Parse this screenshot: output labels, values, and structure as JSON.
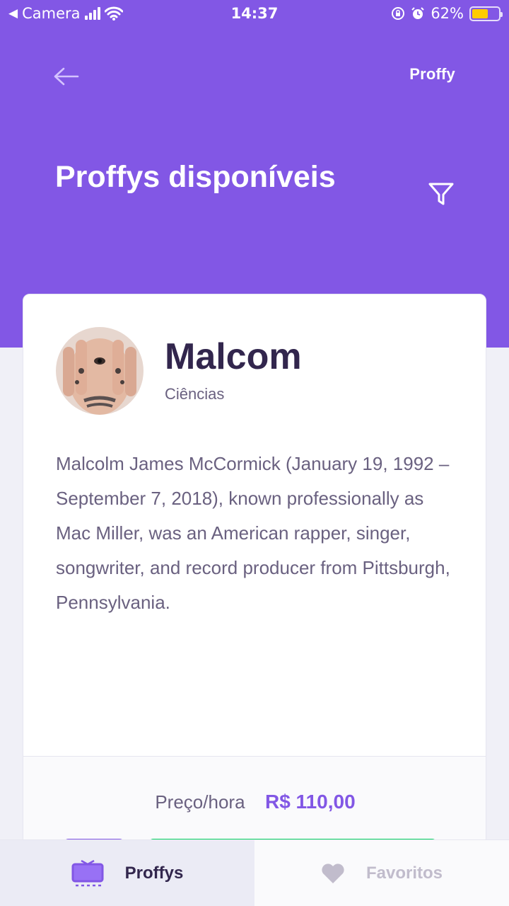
{
  "status_bar": {
    "carrier": "Camera",
    "time": "14:37",
    "battery_percent": "62%",
    "battery_level": 0.62,
    "icons": [
      "back-arrow-icon",
      "signal-icon",
      "wifi-icon",
      "rotation-lock-icon",
      "alarm-icon",
      "battery-icon"
    ]
  },
  "header": {
    "logo": "Proffy",
    "title": "Proffys disponíveis",
    "back_icon": "arrow-left-icon",
    "filter_icon": "filter-icon"
  },
  "teacher": {
    "name": "Malcom",
    "subject": "Ciências",
    "bio": "Malcolm James McCormick (January 19, 1992 – September 7, 2018), known professionally as Mac Miller, was an American rapper, singer, songwriter, and record producer from Pittsburgh, Pennsylvania.",
    "price_label": "Preço/hora",
    "price_value": "R$ 110,00"
  },
  "tabs": [
    {
      "label": "Proffys",
      "icon": "tv-icon",
      "active": true
    },
    {
      "label": "Favoritos",
      "icon": "heart-icon",
      "active": false
    }
  ],
  "colors": {
    "primary": "#8257e5",
    "title": "#32264d",
    "text": "#6a6180",
    "green": "#04d361",
    "inactive": "#c1bccc"
  }
}
